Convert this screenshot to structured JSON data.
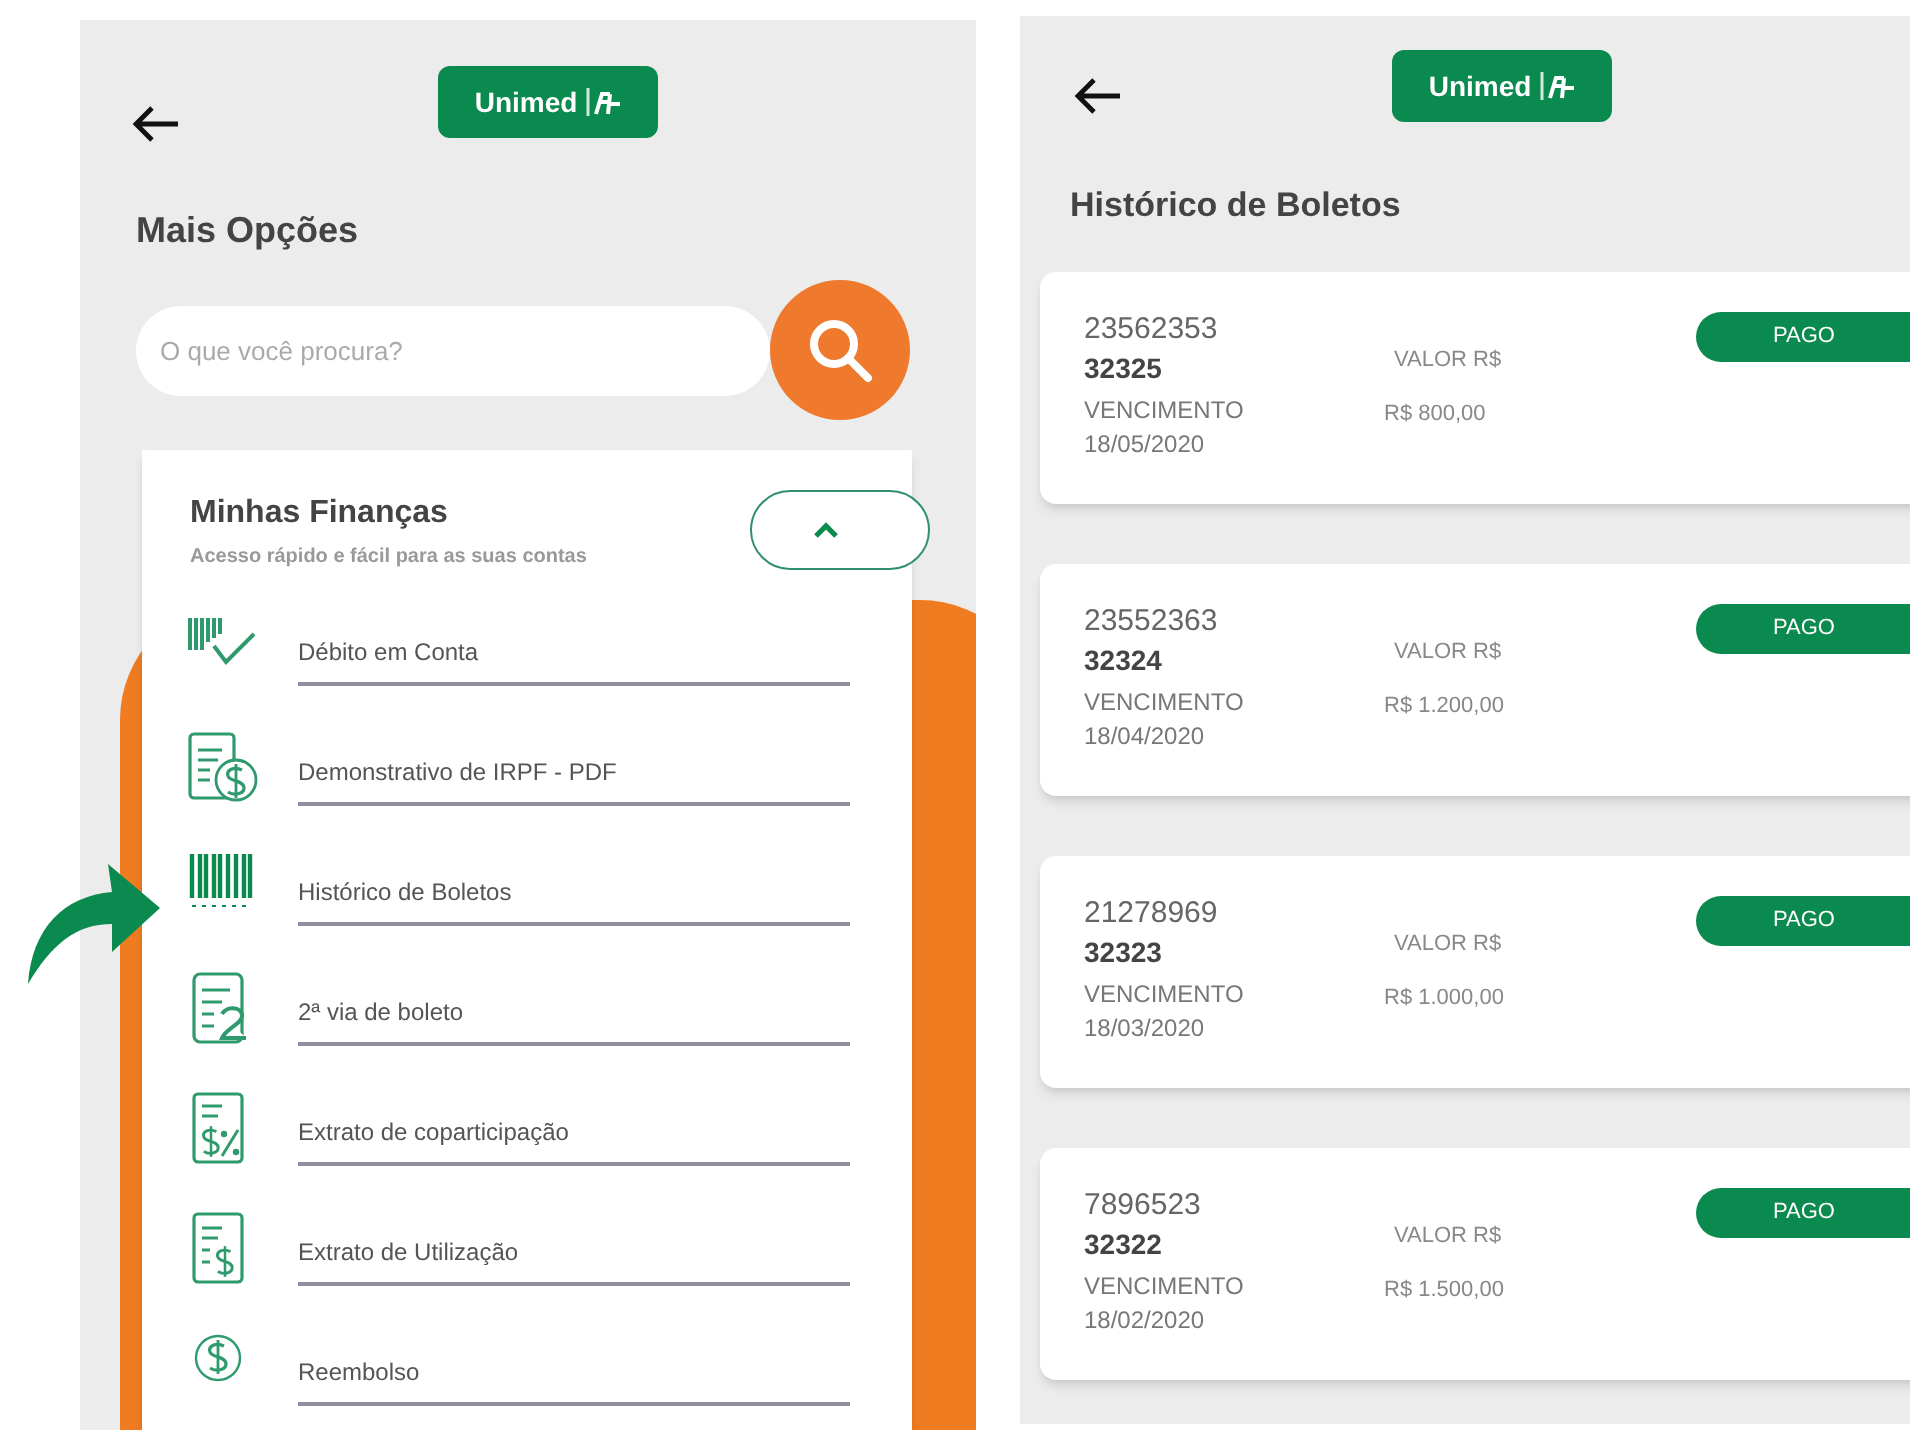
{
  "left_screen": {
    "logo": "Unimed",
    "title": "Mais Opções",
    "search": {
      "placeholder": "O que você procura?"
    },
    "section": {
      "title": "Minhas Finanças",
      "subtitle": "Acesso rápido e fácil para as suas contas",
      "expanded": true
    },
    "items": [
      {
        "label": "Débito em Conta"
      },
      {
        "label": "Demonstrativo de IRPF - PDF"
      },
      {
        "label": "Histórico de Boletos"
      },
      {
        "label": "2ª via de boleto"
      },
      {
        "label": "Extrato de coparticipação"
      },
      {
        "label": "Extrato de Utilização"
      },
      {
        "label": "Reembolso"
      }
    ]
  },
  "right_screen": {
    "logo": "Unimed",
    "title": "Histórico de Boletos",
    "boletos": [
      {
        "number": "23562353",
        "code": "32325",
        "due_label": "VENCIMENTO",
        "due_date": "18/05/2020",
        "value_label": "VALOR R$",
        "value": "R$ 800,00",
        "status": "PAGO"
      },
      {
        "number": "23552363",
        "code": "32324",
        "due_label": "VENCIMENTO",
        "due_date": "18/04/2020",
        "value_label": "VALOR R$",
        "value": "R$ 1.200,00",
        "status": "PAGO"
      },
      {
        "number": "21278969",
        "code": "32323",
        "due_label": "VENCIMENTO",
        "due_date": "18/03/2020",
        "value_label": "VALOR R$",
        "value": "R$ 1.000,00",
        "status": "PAGO"
      },
      {
        "number": "7896523",
        "code": "32322",
        "due_label": "VENCIMENTO",
        "due_date": "18/02/2020",
        "value_label": "VALOR R$",
        "value": "R$ 1.500,00",
        "status": "PAGO"
      }
    ]
  }
}
